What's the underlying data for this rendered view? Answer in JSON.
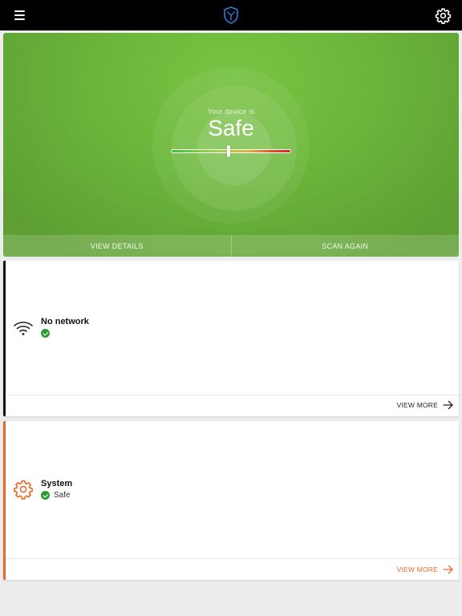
{
  "topbar": {
    "menu_icon": "hamburger-menu-icon",
    "logo_icon": "shield-logo-icon",
    "settings_icon": "gear-icon"
  },
  "hero": {
    "subtitle": "Your device is",
    "status": "Safe",
    "meter_level": 0.48,
    "view_details_label": "VIEW DETAILS",
    "scan_again_label": "SCAN AGAIN"
  },
  "cards": {
    "network": {
      "title": "No network",
      "status_text": "",
      "icon": "wifi-icon",
      "view_more_label": "VIEW MORE",
      "accent_color": "#111111"
    },
    "system": {
      "title": "System",
      "status_text": "Safe",
      "icon": "gear-icon",
      "view_more_label": "VIEW MORE",
      "accent_color": "#e8692c"
    }
  },
  "colors": {
    "topbar": "#000000",
    "hero_green": "#6cb73b",
    "safe_check": "#2e9b2e",
    "logo_blue": "#2f7bd6"
  }
}
